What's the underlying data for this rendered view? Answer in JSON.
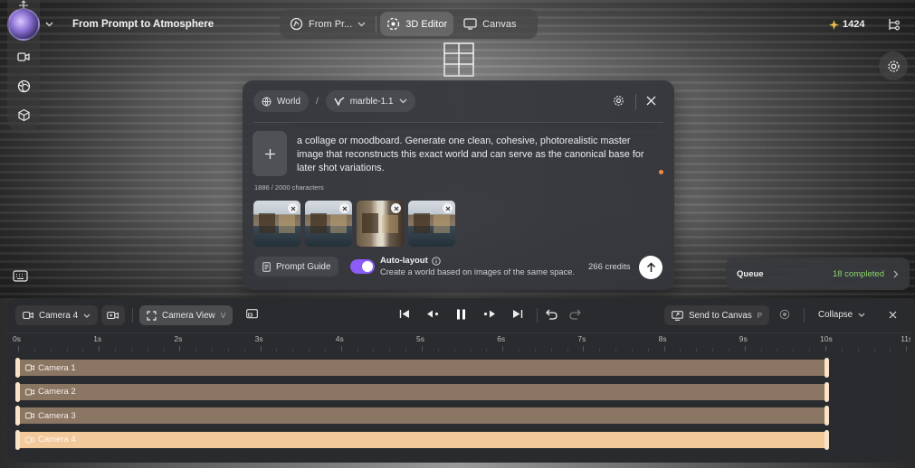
{
  "app": {
    "project_title": "From Prompt to Atmosphere"
  },
  "top_nav": {
    "items": [
      {
        "label": "From Pr...",
        "icon": "prompt-icon"
      },
      {
        "label": "3D Editor",
        "icon": "3d-editor-icon",
        "active": true
      },
      {
        "label": "Canvas",
        "icon": "canvas-icon"
      }
    ]
  },
  "credits": {
    "balance": "1424"
  },
  "prompt_panel": {
    "world_chip": "World",
    "separator": "/",
    "model_chip": "marble-1.1",
    "prompt_text": "a collage or moodboard. Generate one clean, cohesive, photorealistic master image that reconstructs this exact world and can serve as the canonical base for later shot variations.",
    "char_count": "1886 / 2000 characters",
    "prompt_guide_label": "Prompt Guide",
    "auto_layout_title": "Auto-layout",
    "auto_layout_desc": "Create a world based on images of the same space.",
    "auto_layout_enabled": true,
    "credits_cost": "266 credits",
    "image_count": 4
  },
  "queue": {
    "label": "Queue",
    "status": "18 completed"
  },
  "timeline": {
    "camera_select": "Camera 4",
    "camera_view": "Camera View",
    "camera_view_shortcut": "V",
    "send_to_canvas": "Send to Canvas",
    "send_shortcut": "P",
    "collapse": "Collapse",
    "ticks": [
      "0s",
      "1s",
      "2s",
      "3s",
      "4s",
      "5s",
      "6s",
      "7s",
      "8s",
      "9s",
      "10s",
      "11s"
    ],
    "tracks": [
      {
        "label": "Camera 1",
        "selected": false
      },
      {
        "label": "Camera 2",
        "selected": false
      },
      {
        "label": "Camera 3",
        "selected": false
      },
      {
        "label": "Camera 4",
        "selected": true
      }
    ]
  },
  "colors": {
    "accent": "#8b5cf6",
    "queue_status": "#8bd56c",
    "track": "#8b7563",
    "track_selected": "#f2c99b"
  }
}
